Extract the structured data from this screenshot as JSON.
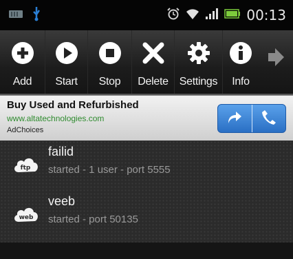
{
  "status_bar": {
    "clock": "00:13",
    "icons": [
      "storage-icon",
      "usb-icon",
      "alarm-icon",
      "wifi-icon",
      "signal-icon",
      "battery-icon"
    ]
  },
  "toolbar": {
    "items": [
      {
        "label": "Add",
        "icon": "add-icon"
      },
      {
        "label": "Start",
        "icon": "play-icon"
      },
      {
        "label": "Stop",
        "icon": "stop-icon"
      },
      {
        "label": "Delete",
        "icon": "delete-icon"
      },
      {
        "label": "Settings",
        "icon": "gear-icon"
      },
      {
        "label": "Info",
        "icon": "info-icon"
      }
    ],
    "overflow_icon": "arrow-right-icon"
  },
  "ad": {
    "title": "Buy Used and Refurbished",
    "url": "www.altatechnologies.com",
    "choices": "AdChoices",
    "accent": "#2a6fc4"
  },
  "servers": [
    {
      "name": "failid",
      "status": "started - 1 user - port 5555",
      "badge": "ftp"
    },
    {
      "name": "veeb",
      "status": "started - port 50135",
      "badge": "web"
    }
  ]
}
